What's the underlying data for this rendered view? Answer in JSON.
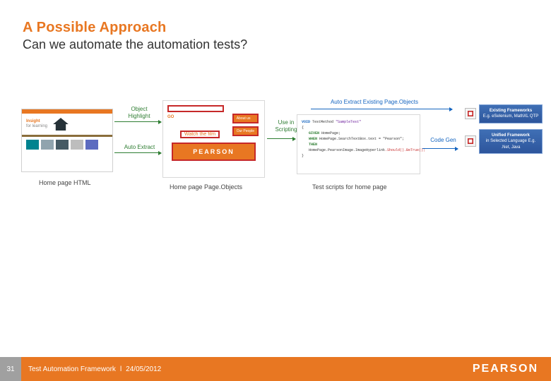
{
  "colors": {
    "accent": "#e87722",
    "blue": "#1565c0",
    "green": "#2e7d32"
  },
  "header": {
    "title": "A Possible Approach",
    "subtitle": "Can we automate the automation tests?"
  },
  "panel1": {
    "brand_line1": "Insight",
    "brand_line2": "for learning",
    "caption": "Home page HTML"
  },
  "panel2": {
    "go": "GO",
    "btn1": "About us",
    "btn2": "Our People",
    "watch": "Watch the film",
    "logo": "PEARSON",
    "caption": "Home page Page.Objects"
  },
  "panel3": {
    "sig_kw": "VOID",
    "sig_name": "TestMethod",
    "sig_arg": "\"SampleTest\"",
    "l1_kw": "GIVEN",
    "l1_rest": " HomePage;",
    "l2_kw": "WHEN",
    "l2_rest": " HomePage.SearchTextBox.text = \"Pearson\";",
    "l3_kw": "THEN",
    "l3_mid": " HomePage.PearsonImage.ImageHyperlink",
    "l3_m1": ".Should()",
    "l3_m2": ".BeTrue();",
    "caption": "Test scripts for home page"
  },
  "arrows": {
    "object_highlight": "Object\nHighlight",
    "auto_extract": "Auto Extract",
    "use_in_scripting": "Use in\nScripting",
    "auto_extract_existing": "Auto Extract Existing Page.Objects",
    "code_gen": "Code Gen"
  },
  "frameworks": {
    "existing_title": "Existing Frameworks",
    "existing_sub": "E.g. eSelenium, MathXL QTP",
    "unified_title": "Unified Framework",
    "unified_sub": "in Selected Language E.g. .Net, Java"
  },
  "footer": {
    "page": "31",
    "text": "Test Automation Framework",
    "sep": "l",
    "date": "24/05/2012",
    "brand": "PEARSON"
  }
}
